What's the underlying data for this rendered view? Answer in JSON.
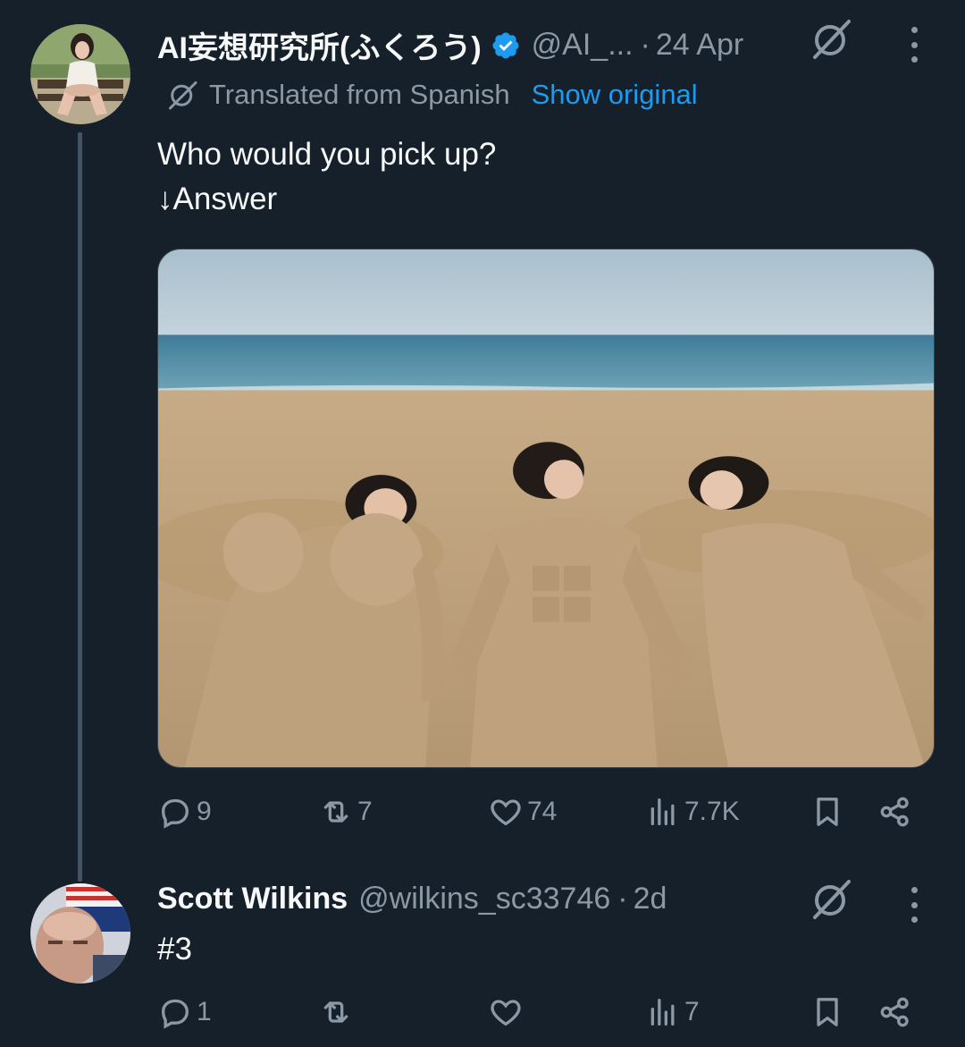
{
  "tweet": {
    "author": {
      "display_name": "AI妄想研究所(ふくろう)",
      "verified": true,
      "handle": "@AI_...",
      "avatar_icon": "avatar-woman-on-bench"
    },
    "separator": "·",
    "time": "24 Apr",
    "translated_label": "Translated from Spanish",
    "show_original_label": "Show original",
    "text_line1": "Who would you pick up?",
    "text_line2": "↓Answer",
    "media": {
      "kind": "photo",
      "scene": "three women buried in sand sculptures on a beach"
    },
    "stats": {
      "replies": "9",
      "reposts": "7",
      "likes": "74",
      "views": "7.7K"
    }
  },
  "reply": {
    "author": {
      "display_name": "Scott Wilkins",
      "handle": "@wilkins_sc33746",
      "avatar_icon": "avatar-man-with-banner"
    },
    "separator": "·",
    "time": "2d",
    "text": "#3",
    "stats": {
      "replies": "1",
      "reposts": "",
      "likes": "",
      "views": "7"
    }
  },
  "colors": {
    "background": "#15202b",
    "primary_text": "#f7f9f9",
    "secondary_text": "#8b98a5",
    "link": "#1d9bf0",
    "verified": "#1d9bf0",
    "thread_line": "#425364"
  }
}
